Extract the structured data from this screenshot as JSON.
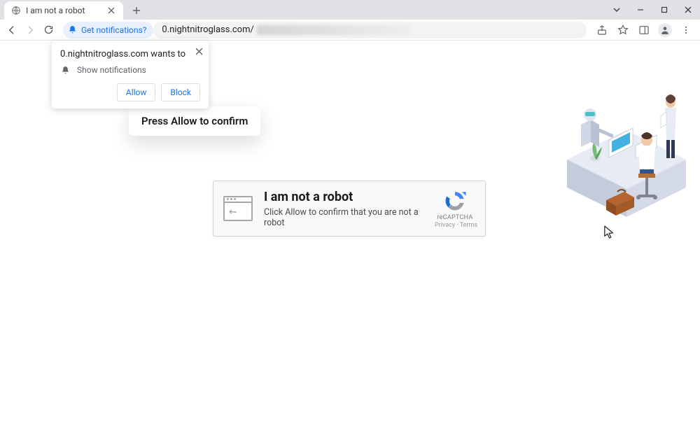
{
  "window": {
    "tab_title": "I am not a robot"
  },
  "toolbar": {
    "notifications_chip": "Get notifications?",
    "url_domain": "0.nightnitroglass.com/"
  },
  "permission_prompt": {
    "origin_text": "0.nightnitroglass.com wants to",
    "capability": "Show notifications",
    "allow_label": "Allow",
    "block_label": "Block"
  },
  "press_allow_card": {
    "text": "Press Allow to confirm"
  },
  "captcha": {
    "title": "I am not a robot",
    "subtitle": "Click Allow to confirm that you are not a robot",
    "badge_label": "reCAPTCHA",
    "badge_privacy": "Privacy",
    "badge_terms": "Terms"
  },
  "colors": {
    "chrome_blue": "#1a73e8",
    "recaptcha_blue": "#4285F4",
    "recaptcha_dark": "#1a6dd6"
  }
}
